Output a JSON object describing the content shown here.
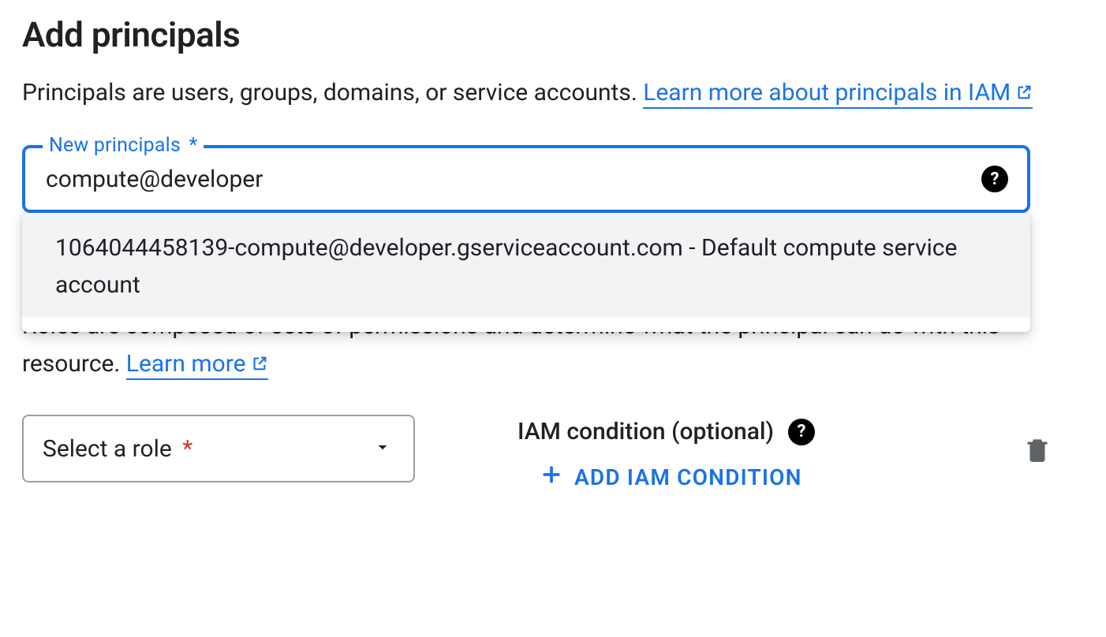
{
  "header": {
    "title": "Add principals"
  },
  "principals": {
    "description_prefix": "Principals are users, groups, domains, or service accounts. ",
    "learn_more_label": "Learn more about principals in IAM",
    "input_label": "New principals",
    "input_required_marker": "*",
    "input_value": "compute@developer",
    "help_tooltip_glyph": "?",
    "suggestions": [
      {
        "text": "1064044458139-compute@developer.gserviceaccount.com - Default compute service account"
      }
    ]
  },
  "roles": {
    "description_prefix": "Roles are composed of sets of permissions and determine what the principal can do with this resource. ",
    "learn_more_label": "Learn more",
    "select_placeholder": "Select a role",
    "select_required_marker": "*",
    "condition_label": "IAM condition (optional)",
    "add_condition_label": "ADD IAM CONDITION"
  },
  "icons": {
    "external_link": "external-link-icon",
    "help": "help-icon",
    "caret_down": "caret-down-icon",
    "plus": "plus-icon",
    "trash": "trash-icon"
  },
  "colors": {
    "primary_blue": "#1a73e8",
    "required_red": "#d93025"
  }
}
